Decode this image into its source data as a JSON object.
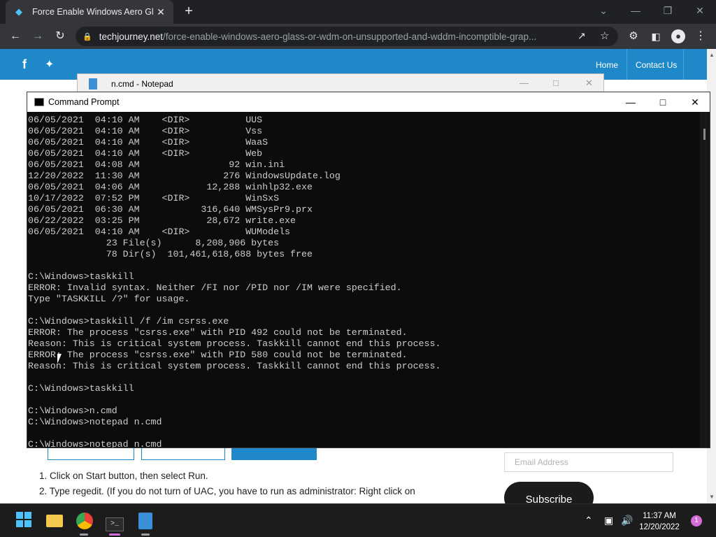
{
  "browser": {
    "tab_title": "Force Enable Windows Aero Glass",
    "url_domain": "techjourney.net",
    "url_path": "/force-enable-windows-aero-glass-or-wdm-on-unsupported-and-wddm-incomptible-grap..."
  },
  "webpage": {
    "nav": [
      "Home",
      "Contact Us"
    ],
    "steps_fragment": {
      "step1": "1. Click on Start button, then select Run.",
      "step2": "2. Type regedit. (If you do not turn of UAC, you have to run as administrator: Right click on"
    },
    "email_placeholder": "Email Address",
    "subscribe_label": "Subscribe"
  },
  "notepad": {
    "title": "n.cmd - Notepad"
  },
  "cmd": {
    "title": "Command Prompt",
    "lines": [
      "06/05/2021  04:10 AM    <DIR>          UUS",
      "06/05/2021  04:10 AM    <DIR>          Vss",
      "06/05/2021  04:10 AM    <DIR>          WaaS",
      "06/05/2021  04:10 AM    <DIR>          Web",
      "06/05/2021  04:08 AM                92 win.ini",
      "12/20/2022  11:30 AM               276 WindowsUpdate.log",
      "06/05/2021  04:06 AM            12,288 winhlp32.exe",
      "10/17/2022  07:52 PM    <DIR>          WinSxS",
      "06/05/2021  06:30 AM           316,640 WMSysPr9.prx",
      "06/22/2022  03:25 PM            28,672 write.exe",
      "06/05/2021  04:10 AM    <DIR>          WUModels",
      "              23 File(s)      8,208,906 bytes",
      "              78 Dir(s)  101,461,618,688 bytes free",
      "",
      "C:\\Windows>taskkill",
      "ERROR: Invalid syntax. Neither /FI nor /PID nor /IM were specified.",
      "Type \"TASKKILL /?\" for usage.",
      "",
      "C:\\Windows>taskkill /f /im csrss.exe",
      "ERROR: The process \"csrss.exe\" with PID 492 could not be terminated.",
      "Reason: This is critical system process. Taskkill cannot end this process.",
      "ERROR: The process \"csrss.exe\" with PID 580 could not be terminated.",
      "Reason: This is critical system process. Taskkill cannot end this process.",
      "",
      "C:\\Windows>taskkill",
      "",
      "C:\\Windows>n.cmd",
      "C:\\Windows>notepad n.cmd",
      "",
      "C:\\Windows>notepad n.cmd_"
    ]
  },
  "taskbar": {
    "time": "11:37 AM",
    "date": "12/20/2022",
    "notification_count": "1"
  }
}
